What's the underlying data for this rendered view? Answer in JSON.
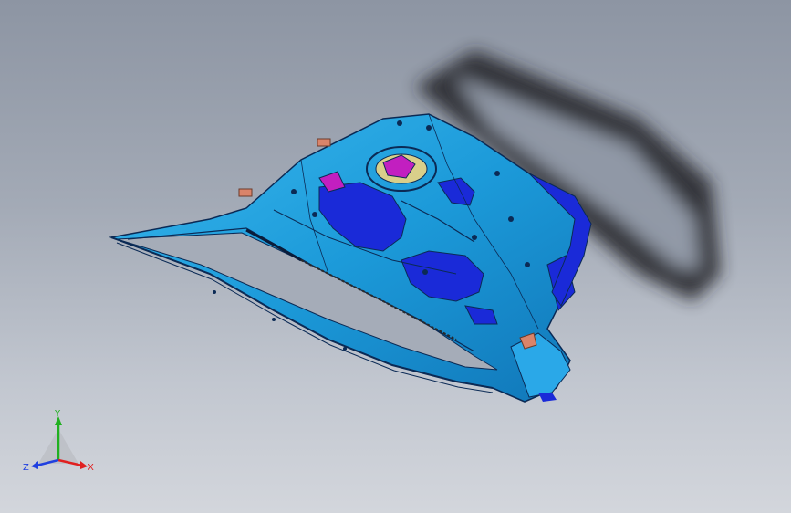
{
  "viewport": {
    "background_top": "#8d95a3",
    "background_bottom": "#d3d6dc"
  },
  "model": {
    "body_color": "#1e9fe0",
    "edge_color": "#0b2a55",
    "highlight_color": "#1a2ad8",
    "accent_magenta": "#c21fc0",
    "accent_yellow": "#d9cf8a",
    "tab_color": "#d9846a",
    "shadow_color": "#222428"
  },
  "triad": {
    "x_label": "X",
    "y_label": "Y",
    "z_label": "Z",
    "x_color": "#e02020",
    "y_color": "#20b020",
    "z_color": "#2040e0"
  }
}
